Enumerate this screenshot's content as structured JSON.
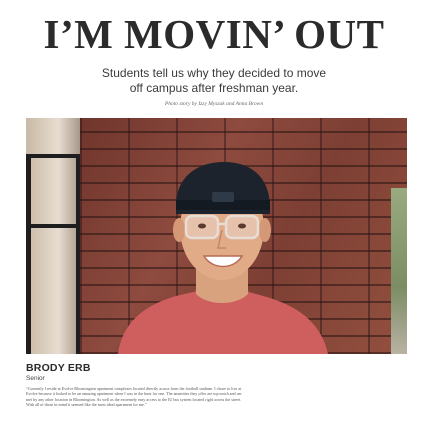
{
  "article": {
    "headline": "I’M MOVIN’ OUT",
    "dek_lines": [
      "Students tell us why they decided to move",
      "off campus after freshman year."
    ],
    "photo_credit": "Photo story by Izzy Myszak and Anna Brown"
  },
  "profile": {
    "name": "BRODY ERB",
    "year": "Senior",
    "quote_lines": [
      "“Currently I reside at Evolve Bloomington apartment complexes located directly across from the football stadium. I chose to live at",
      "Evolve because it looked to be an amazing apartment when I was in the hunt for one. The amenities they offer are top notch and un-",
      "met by any other location in Bloomington. As well as the extremely easy access to the IU bus system located right across the street.",
      "With all of those in mind it seemed like the most ideal apartment for me.”"
    ]
  }
}
